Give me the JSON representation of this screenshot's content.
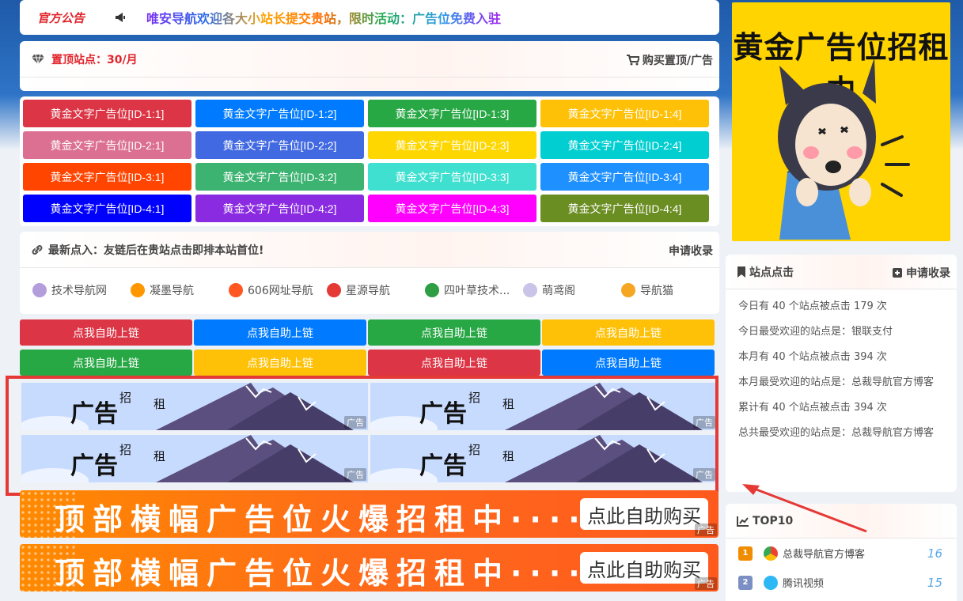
{
  "notice": {
    "tag": "官方公告",
    "text": "唯安导航欢迎各大小站长提交贵站，限时活动：广告位免费入驻"
  },
  "pin": {
    "title": "置顶站点：30/月",
    "buy_label": "购买置顶/广告"
  },
  "text_ads": [
    {
      "label": "黄金文字广告位[ID-1:1]",
      "color": "#dc3545"
    },
    {
      "label": "黄金文字广告位[ID-1:2]",
      "color": "#007bff"
    },
    {
      "label": "黄金文字广告位[ID-1:3]",
      "color": "#28a745"
    },
    {
      "label": "黄金文字广告位[ID-1:4]",
      "color": "#ffc107"
    },
    {
      "label": "黄金文字广告位[ID-2:1]",
      "color": "#db7093"
    },
    {
      "label": "黄金文字广告位[ID-2:2]",
      "color": "#4169e1"
    },
    {
      "label": "黄金文字广告位[ID-2:3]",
      "color": "#ffd700"
    },
    {
      "label": "黄金文字广告位[ID-2:4]",
      "color": "#00ced1"
    },
    {
      "label": "黄金文字广告位[ID-3:1]",
      "color": "#ff4500"
    },
    {
      "label": "黄金文字广告位[ID-3:2]",
      "color": "#3cb371"
    },
    {
      "label": "黄金文字广告位[ID-3:3]",
      "color": "#40e0d0"
    },
    {
      "label": "黄金文字广告位[ID-3:4]",
      "color": "#1e90ff"
    },
    {
      "label": "黄金文字广告位[ID-4:1]",
      "color": "#0000ff"
    },
    {
      "label": "黄金文字广告位[ID-4:2]",
      "color": "#8a2be2"
    },
    {
      "label": "黄金文字广告位[ID-4:3]",
      "color": "#ff00ff"
    },
    {
      "label": "黄金文字广告位[ID-4:4]",
      "color": "#6b8e23"
    }
  ],
  "newest": {
    "title": "最新点入：友链后在贵站点击即排本站首位!",
    "apply_label": "申请收录",
    "links": [
      {
        "name": "技术导航网",
        "icon": "cloud-icon",
        "color": "#b39ddb"
      },
      {
        "name": "凝墨导航",
        "icon": "colorful-logo-icon",
        "color": "#ff9800"
      },
      {
        "name": "606网址导航",
        "icon": "number-six-icon",
        "color": "#ff5722"
      },
      {
        "name": "星源导航",
        "icon": "star-source-icon",
        "color": "#e53935"
      },
      {
        "name": "四叶草技术...",
        "icon": "clover-icon",
        "color": "#2e9e44"
      },
      {
        "name": "萌鸢阁",
        "icon": "anime-avatar-icon",
        "color": "#c9c4e8"
      },
      {
        "name": "导航猫",
        "icon": "cat-badge-icon",
        "color": "#f5a623"
      }
    ]
  },
  "self_links": [
    {
      "label": "点我自助上链",
      "color": "#dc3545"
    },
    {
      "label": "点我自助上链",
      "color": "#007bff"
    },
    {
      "label": "点我自助上链",
      "color": "#28a745"
    },
    {
      "label": "点我自助上链",
      "color": "#ffc107"
    },
    {
      "label": "点我自助上链",
      "color": "#28a745"
    },
    {
      "label": "点我自助上链",
      "color": "#ffc107"
    },
    {
      "label": "点我自助上链",
      "color": "#dc3545"
    },
    {
      "label": "点我自助上链",
      "color": "#007bff"
    }
  ],
  "banner_ads": [
    {
      "t1": "广告",
      "t2": "招",
      "t3": "租",
      "tag": "广告"
    },
    {
      "t1": "广告",
      "t2": "招",
      "t3": "租",
      "tag": "广告"
    },
    {
      "t1": "广告",
      "t2": "招",
      "t3": "租",
      "tag": "广告"
    },
    {
      "t1": "广告",
      "t2": "招",
      "t3": "租",
      "tag": "广告"
    }
  ],
  "orange_banners": [
    {
      "slogan": "顶部横幅广告位火爆招租中······",
      "button": "点此自助购买",
      "tag": "广告"
    },
    {
      "slogan": "顶部横幅广告位火爆招租中······",
      "button": "点此自助购买",
      "tag": "广告"
    }
  ],
  "sidebar_ad": {
    "title": "黄金广告位招租中"
  },
  "stats": {
    "title": "站点点击",
    "apply_label": "申请收录",
    "lines": [
      "今日有 40 个站点被点击 179 次",
      "今日最受欢迎的站点是：银联支付",
      "本月有 40 个站点被点击 394 次",
      "本月最受欢迎的站点是：总裁导航官方博客",
      "累计有 40 个站点被点击 394 次",
      "总共最受欢迎的站点是：总裁导航官方博客"
    ]
  },
  "top10": {
    "title": "TOP10",
    "items": [
      {
        "rank": "1",
        "name": "总裁导航官方博客",
        "count": "16",
        "icon": "chrome-icon"
      },
      {
        "rank": "2",
        "name": "腾讯视频",
        "count": "15",
        "icon": "tencent-video-icon"
      }
    ]
  },
  "colors": {
    "accent_red": "#e0242b",
    "highlight": "#e53935",
    "orange": "#ff6a1a"
  }
}
